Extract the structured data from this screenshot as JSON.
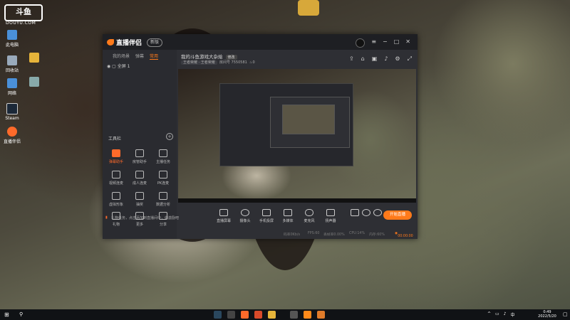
{
  "desktop": {
    "watermark_logo": "斗鱼",
    "watermark_sub": "DOUYU.COM",
    "icons": [
      {
        "label": "此电脑",
        "icon": "computer-icon",
        "color": "#4a90d9"
      },
      {
        "label": "回收站",
        "icon": "recycle-bin-icon",
        "color": "#9ab"
      },
      {
        "label": "网络",
        "icon": "network-icon",
        "color": "#4a90d9"
      },
      {
        "label": "Steam",
        "icon": "steam-icon",
        "color": "#1b2838"
      },
      {
        "label": "直播伴侣",
        "icon": "douyu-icon",
        "color": "#ff6a2a"
      }
    ]
  },
  "app": {
    "brand": "直播伴侣",
    "version_pill": "新版",
    "titlebar_icons": [
      "avatar",
      "menu-icon",
      "minimize-icon",
      "maximize-icon",
      "close-icon"
    ],
    "sidebar": {
      "tabs": [
        "我的场景",
        "弹幕",
        "常用"
      ],
      "active_tab": "常用",
      "scene_label": "全屏 1",
      "tools_title": "工具栏",
      "tools": [
        {
          "label": "弹幕助手",
          "highlight": true
        },
        {
          "label": "房管助手",
          "highlight": false
        },
        {
          "label": "主播任务",
          "highlight": false
        },
        {
          "label": "视频连麦",
          "highlight": false
        },
        {
          "label": "成人连麦",
          "highlight": false
        },
        {
          "label": "PK连麦",
          "highlight": false
        },
        {
          "label": "虚拟形象",
          "highlight": false
        },
        {
          "label": "抽奖",
          "highlight": false
        },
        {
          "label": "数据分析",
          "highlight": false
        },
        {
          "label": "礼物",
          "highlight": false
        },
        {
          "label": "更多",
          "highlight": false
        },
        {
          "label": "分享",
          "highlight": false
        }
      ],
      "notice": "礼物任务，点击添加到直播间中，做激励吧"
    },
    "main": {
      "room_title": "我的斗鱼游戏大杂烩",
      "edit_label": "修改",
      "category": "王者荣耀 · 王者荣耀",
      "room_id": "房间号 7550581",
      "hot": "0",
      "top_icons": [
        "share-icon",
        "lock-icon",
        "window-icon",
        "bell-icon",
        "settings-icon",
        "fullscreen-icon"
      ],
      "controls": [
        {
          "label": "直播屏幕",
          "icon": "screen-icon"
        },
        {
          "label": "摄像头",
          "icon": "camera-icon"
        },
        {
          "label": "手机投屏",
          "icon": "phone-icon"
        },
        {
          "label": "多媒体",
          "icon": "media-icon"
        },
        {
          "label": "麦克风",
          "icon": "mic-icon"
        },
        {
          "label": "扬声器",
          "icon": "speaker-icon"
        },
        {
          "label": "录制",
          "icon": "record-icon"
        },
        {
          "label": "预览",
          "icon": "eye-icon"
        },
        {
          "label": "设置",
          "icon": "settings-icon"
        }
      ],
      "start_button": "开始直播",
      "stats": [
        "码率0Kb/s",
        "FPS:60",
        "丢帧率0.00%",
        "CPU:14%",
        "内存:60%"
      ],
      "timer": "00:00:00"
    }
  },
  "taskbar": {
    "start_icon": "windows-icon",
    "search_icon": "search-icon",
    "apps": [
      {
        "icon": "steam-icon",
        "color": "#2a475e"
      },
      {
        "icon": "controller-icon",
        "color": "#444"
      },
      {
        "icon": "douyu-icon",
        "color": "#ff6a2a"
      },
      {
        "icon": "editor-icon",
        "color": "#d94a2a"
      },
      {
        "icon": "folder-icon",
        "color": "#e6b43a"
      },
      {
        "icon": "app-icon",
        "color": "#555"
      },
      {
        "icon": "flame-icon",
        "color": "#ff8a1a"
      },
      {
        "icon": "browser-icon",
        "color": "#e07b2a"
      }
    ],
    "time": "0:49",
    "date": "2022/5/20"
  }
}
